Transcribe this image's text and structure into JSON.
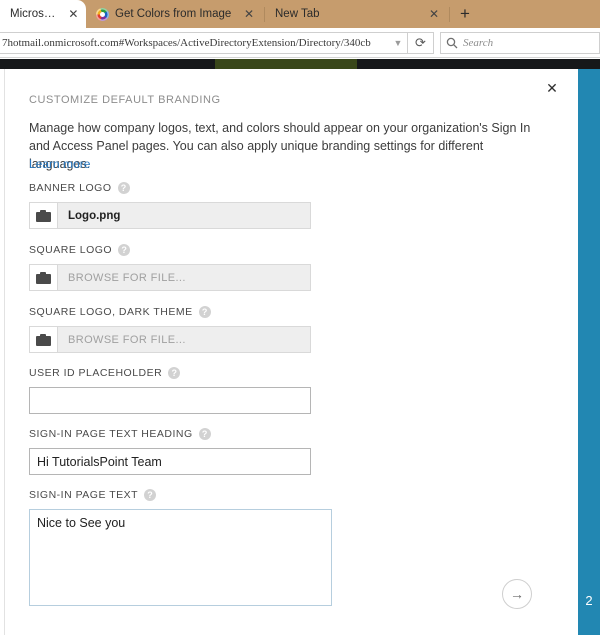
{
  "browser": {
    "tabs": [
      {
        "title": "Microso...",
        "favicon": null,
        "active": true,
        "close_label": "✕"
      },
      {
        "title": "Get Colors from Image",
        "favicon": "color-wheel-icon",
        "active": false,
        "close_label": "✕"
      },
      {
        "title": "New Tab",
        "favicon": null,
        "active": false,
        "close_label": "✕"
      }
    ],
    "new_tab_label": "+",
    "url": "7hotmail.onmicrosoft.com#Workspaces/ActiveDirectoryExtension/Directory/340cb",
    "url_dropdown_glyph": "▼",
    "reload_glyph": "⟳",
    "search_placeholder": "Search",
    "search_icon": "search-icon"
  },
  "rail": {
    "step_number": "2",
    "color": "#2287b2"
  },
  "dialog": {
    "close_label": "✕",
    "kicker": "CUSTOMIZE DEFAULT BRANDING",
    "description": "Manage how company logos, text, and colors should appear on your organization's Sign In and Access Panel pages. You can also apply unique branding settings for different languages.",
    "learn_more": "Learn more",
    "learn_more_color": "#2878c0",
    "next_button_glyph": "→",
    "help_glyph": "?",
    "fields": [
      {
        "label": "BANNER LOGO",
        "type": "file",
        "value": "Logo.png",
        "placeholder": "",
        "icon": "folder-icon"
      },
      {
        "label": "SQUARE LOGO",
        "type": "file",
        "value": "",
        "placeholder": "BROWSE FOR FILE...",
        "icon": "folder-icon"
      },
      {
        "label": "SQUARE LOGO, DARK THEME",
        "type": "file",
        "value": "",
        "placeholder": "BROWSE FOR FILE...",
        "icon": "folder-icon"
      },
      {
        "label": "USER ID PLACEHOLDER",
        "type": "text",
        "value": "",
        "placeholder": ""
      },
      {
        "label": "SIGN-IN PAGE TEXT HEADING",
        "type": "text",
        "value": "Hi TutorialsPoint Team",
        "placeholder": ""
      },
      {
        "label": "SIGN-IN PAGE TEXT",
        "type": "textarea",
        "value": "Nice to See you",
        "placeholder": ""
      }
    ]
  }
}
